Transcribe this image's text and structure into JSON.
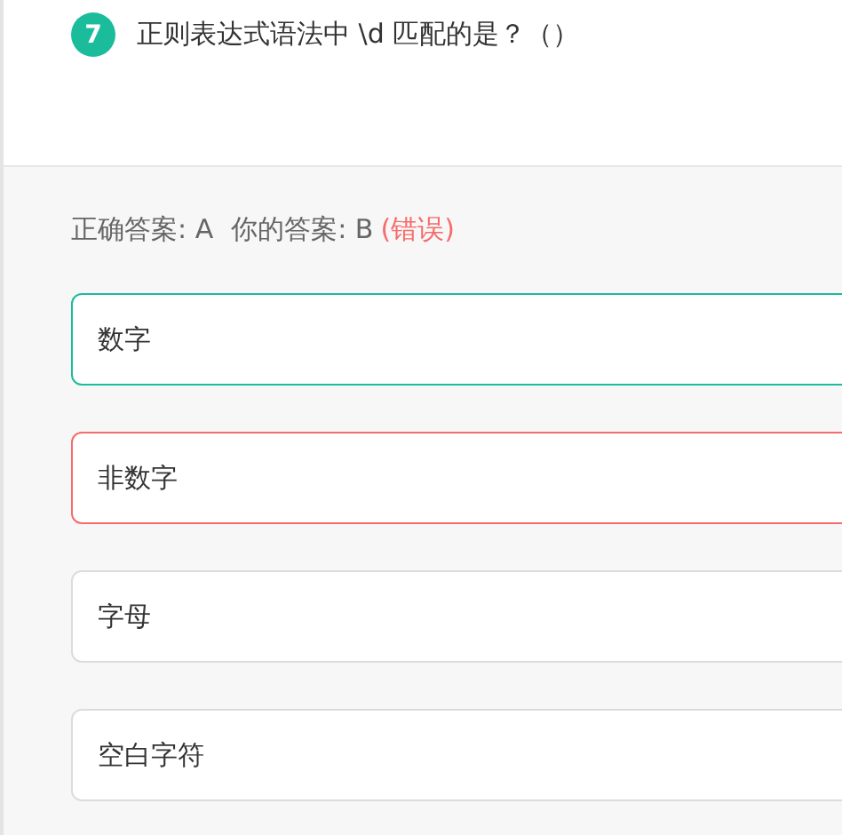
{
  "question": {
    "number": "7",
    "text": "正则表达式语法中 \\d 匹配的是？（）"
  },
  "result": {
    "correct_label": "正确答案: A",
    "your_label": "你的答案: B",
    "verdict": "(错误)"
  },
  "options": [
    {
      "text": "数字",
      "correct": true,
      "wrong": false
    },
    {
      "text": "非数字",
      "correct": false,
      "wrong": true
    },
    {
      "text": "字母",
      "correct": false,
      "wrong": false
    },
    {
      "text": "空白字符",
      "correct": false,
      "wrong": false
    }
  ]
}
